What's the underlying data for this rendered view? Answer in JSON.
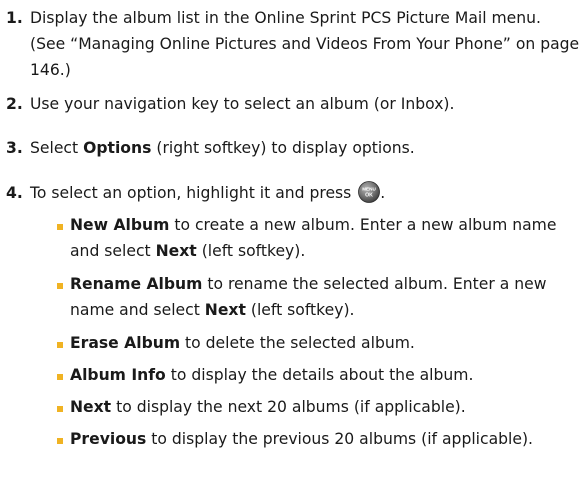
{
  "steps": [
    {
      "number": "1.",
      "text": "Display the album list in the Online Sprint PCS Picture Mail menu. (See “Managing Online Pictures and Videos From Your Phone” on page 146.)"
    },
    {
      "number": "2.",
      "text": "Use your navigation key to select an album (or Inbox)."
    },
    {
      "number": "3.",
      "pre": "Select ",
      "bold": "Options",
      "post": " (right softkey) to display options."
    },
    {
      "number": "4.",
      "text": "To select an option, highlight it and press",
      "post": ".",
      "icon": "menu-ok-key-icon",
      "icon_label_top": "MENU",
      "icon_label_bottom": "OK"
    }
  ],
  "options": [
    {
      "name": "New Album",
      "pre": " to create a new album. Enter a new album name and select ",
      "bold2": "Next",
      "post": " (left softkey)."
    },
    {
      "name": "Rename Album",
      "pre": " to rename the selected album. Enter a new name and select ",
      "bold2": "Next",
      "post": " (left softkey)."
    },
    {
      "name": "Erase Album",
      "pre": " to delete the selected album."
    },
    {
      "name": "Album Info",
      "pre": " to display the details about the album."
    },
    {
      "name": "Next",
      "pre": " to display the next 20 albums (if applicable)."
    },
    {
      "name": "Previous",
      "pre": " to display the previous 20 albums (if applicable)."
    }
  ],
  "colors": {
    "bullet": "#f0b323",
    "text": "#1a1a1a"
  }
}
